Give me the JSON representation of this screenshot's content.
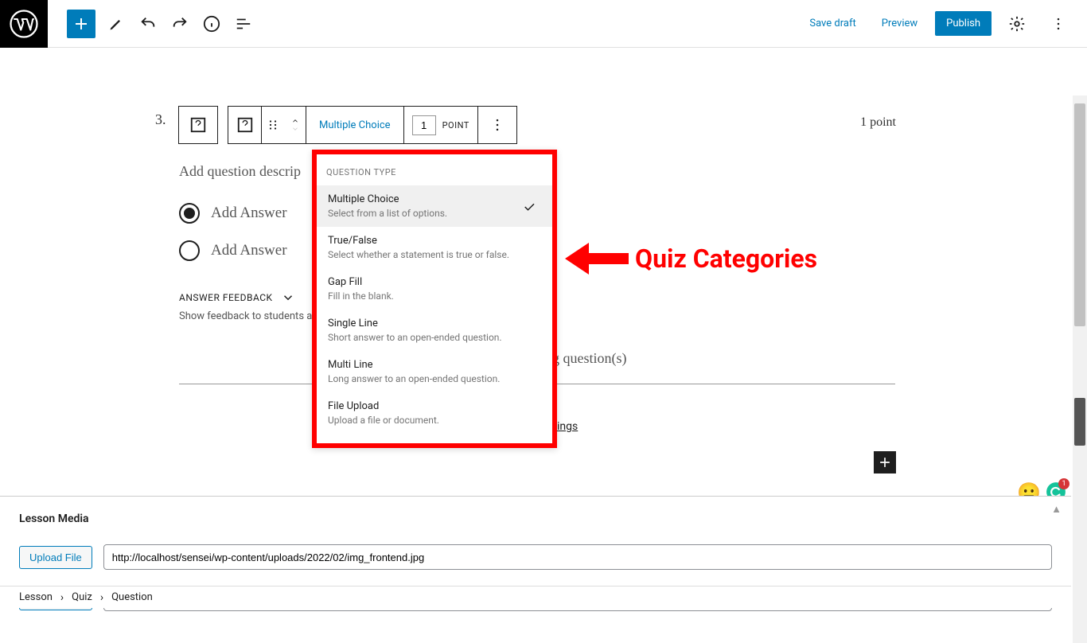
{
  "topbar": {
    "save_draft": "Save draft",
    "preview": "Preview",
    "publish": "Publish"
  },
  "question": {
    "number": "3.",
    "type_label": "Multiple Choice",
    "point_value": "1",
    "point_unit": "POINT",
    "points_display": "1 point",
    "description_placeholder": "Add question descrip",
    "answer1": "Add Answer",
    "answer2": "Add Answer",
    "feedback_label": "ANSWER FEEDBACK",
    "feedback_desc": "Show feedback to students afte",
    "existing_text": "g question(s)",
    "settings_link": "ings"
  },
  "dropdown": {
    "header": "QUESTION TYPE",
    "items": [
      {
        "title": "Multiple Choice",
        "desc": "Select from a list of options.",
        "selected": true
      },
      {
        "title": "True/False",
        "desc": "Select whether a statement is true or false.",
        "selected": false
      },
      {
        "title": "Gap Fill",
        "desc": "Fill in the blank.",
        "selected": false
      },
      {
        "title": "Single Line",
        "desc": "Short answer to an open-ended question.",
        "selected": false
      },
      {
        "title": "Multi Line",
        "desc": "Long answer to an open-ended question.",
        "selected": false
      },
      {
        "title": "File Upload",
        "desc": "Upload a file or document.",
        "selected": false
      }
    ]
  },
  "annotation": {
    "label": "Quiz Categories"
  },
  "lesson_media": {
    "title": "Lesson Media",
    "upload_label": "Upload File",
    "file_path": "http://localhost/sensei/wp-content/uploads/2022/02/img_frontend.jpg"
  },
  "breadcrumb": {
    "item1": "Lesson",
    "item2": "Quiz",
    "item3": "Question"
  },
  "badge": {
    "count": "1"
  }
}
